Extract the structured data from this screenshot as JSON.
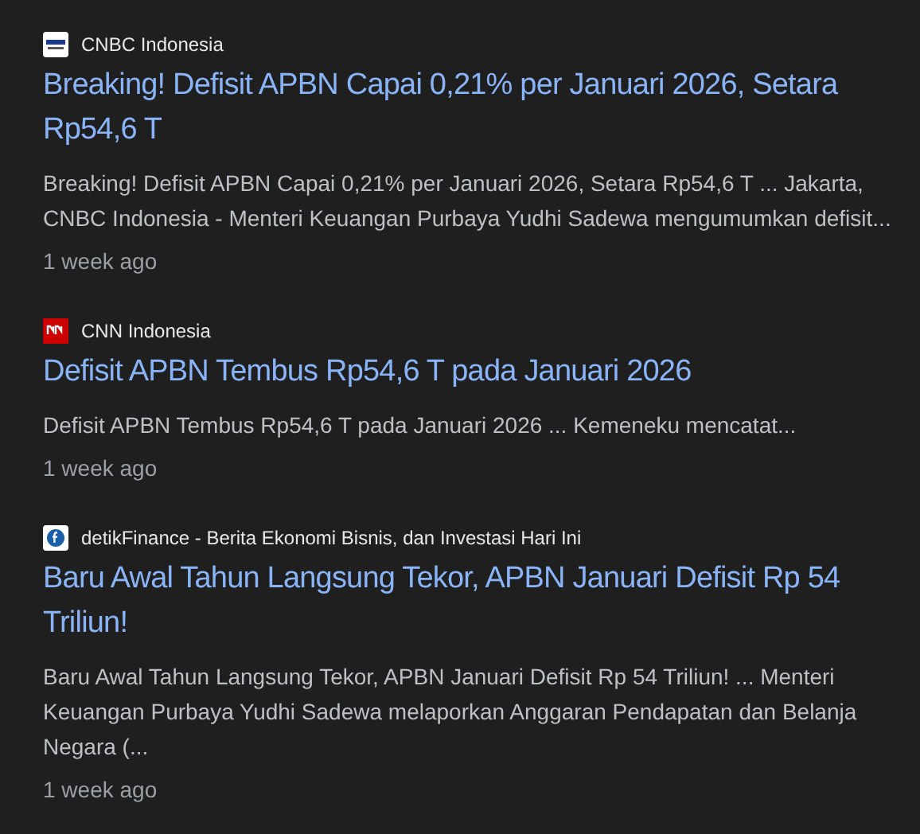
{
  "results": [
    {
      "source": {
        "name": "CNBC Indonesia",
        "kind": "cnbc"
      },
      "title": "Breaking! Defisit APBN Capai 0,21% per Januari 2026, Setara Rp54,6 T",
      "snippet": "Breaking! Defisit APBN Capai 0,21% per Januari 2026, Setara Rp54,6 T ... Jakarta, CNBC Indonesia - Menteri Keuangan Purbaya Yudhi Sadewa mengumumkan defisit...",
      "time": "1 week ago"
    },
    {
      "source": {
        "name": "CNN Indonesia",
        "kind": "cnn"
      },
      "title": "Defisit APBN Tembus Rp54,6 T pada Januari 2026",
      "snippet": "Defisit APBN Tembus Rp54,6 T pada Januari 2026 ... Kemeneku mencatat...",
      "time": "1 week ago"
    },
    {
      "source": {
        "name": "detikFinance - Berita Ekonomi Bisnis, dan Investasi Hari Ini",
        "kind": "detik"
      },
      "title": "Baru Awal Tahun Langsung Tekor, APBN Januari Defisit Rp 54 Triliun!",
      "snippet": "Baru Awal Tahun Langsung Tekor, APBN Januari Defisit Rp 54 Triliun! ... Menteri Keuangan Purbaya Yudhi Sadewa melaporkan Anggaran Pendapatan dan Belanja Negara (...",
      "time": "1 week ago"
    }
  ]
}
